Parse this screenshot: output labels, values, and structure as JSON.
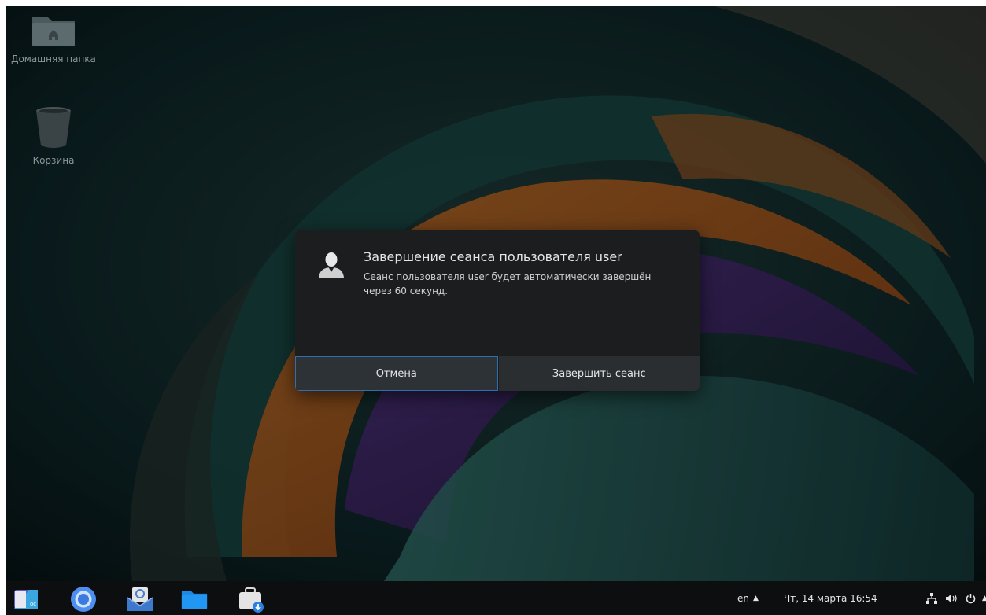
{
  "desktop": {
    "icons": [
      {
        "label": "Домашняя папка",
        "icon": "home-folder-icon"
      },
      {
        "label": "Корзина",
        "icon": "trash-icon"
      }
    ]
  },
  "dialog": {
    "icon": "user-avatar-icon",
    "title": "Завершение сеанса пользователя user",
    "message": "Сеанс пользователя user будет автоматически завершён через 60 секунд.",
    "cancel_label": "Отмена",
    "logout_label": "Завершить сеанс"
  },
  "taskbar": {
    "apps": [
      {
        "name": "office-suite-icon"
      },
      {
        "name": "browser-icon"
      },
      {
        "name": "mail-client-icon"
      },
      {
        "name": "file-manager-icon"
      },
      {
        "name": "software-installer-icon"
      }
    ],
    "language": "en",
    "datetime": "Чт, 14 марта 16:54"
  },
  "colors": {
    "dialog_bg": "#1c1d1f",
    "button_bg": "#2b2e30",
    "focus_border": "#2f6fb0",
    "taskbar_bg": "#0d0e0f"
  }
}
